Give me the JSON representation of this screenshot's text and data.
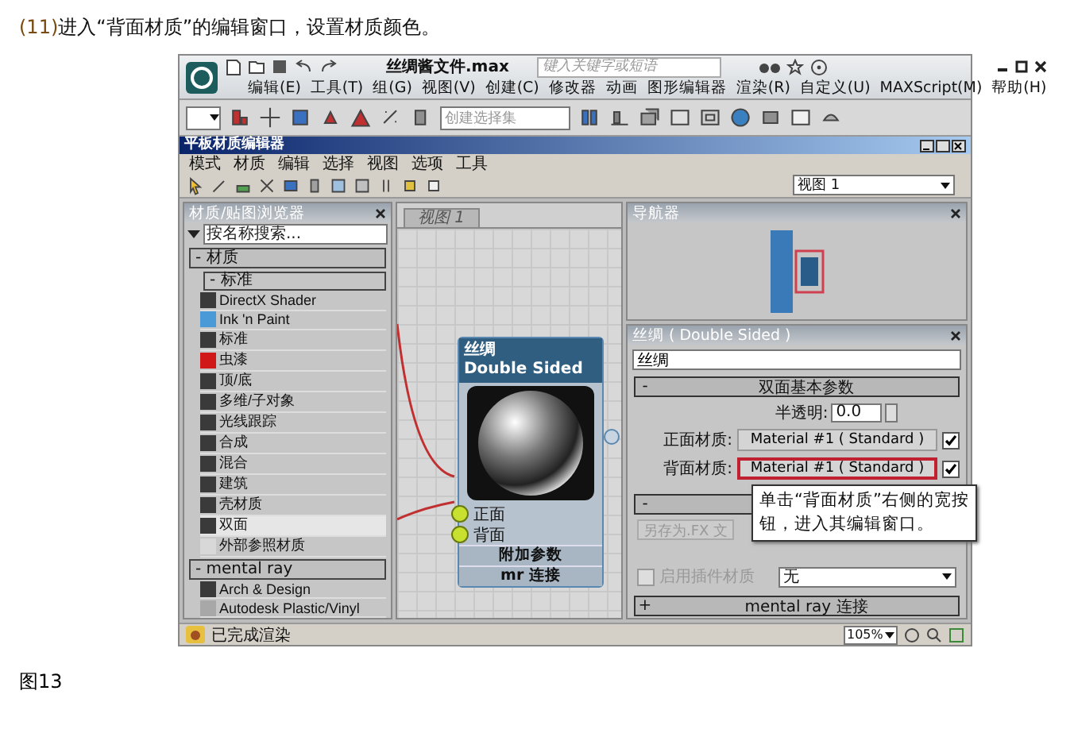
{
  "step_number": "(11)",
  "caption": "进入“背面材质”的编辑窗口，设置材质颜色。",
  "app": {
    "title": "丝绸酱文件.max",
    "search_placeholder": "键入关键字或短语",
    "menu": [
      "编辑(E)",
      "工具(T)",
      "组(G)",
      "视图(V)",
      "创建(C)",
      "修改器",
      "动画",
      "图形编辑器",
      "渲染(R)",
      "自定义(U)",
      "MAXScript(M)",
      "帮助(H)"
    ],
    "selection_set_placeholder": "创建选择集",
    "editor": {
      "title": "平板材质编辑器",
      "menu": [
        "模式",
        "材质",
        "编辑",
        "选择",
        "视图",
        "选项",
        "工具"
      ],
      "view_dropdown": "视图 1",
      "browser": {
        "title": "材质/贴图浏览器",
        "search_placeholder": "按名称搜索...",
        "groups": [
          {
            "label": "- 材质",
            "children": [
              {
                "label": "- 标准",
                "items": [
                  {
                    "label": "DirectX Shader",
                    "color": "#3a3a3a",
                    "selected": false
                  },
                  {
                    "label": "Ink 'n Paint",
                    "color": "#4a9ad8",
                    "selected": false
                  },
                  {
                    "label": "标准",
                    "color": "#3a3a3a",
                    "selected": false
                  },
                  {
                    "label": "虫漆",
                    "color": "#d01818",
                    "selected": false
                  },
                  {
                    "label": "顶/底",
                    "color": "#3a3a3a",
                    "selected": false
                  },
                  {
                    "label": "多维/子对象",
                    "color": "#3a3a3a",
                    "selected": false
                  },
                  {
                    "label": "光线跟踪",
                    "color": "#3a3a3a",
                    "selected": false
                  },
                  {
                    "label": "合成",
                    "color": "#3a3a3a",
                    "selected": false
                  },
                  {
                    "label": "混合",
                    "color": "#3a3a3a",
                    "selected": false
                  },
                  {
                    "label": "建筑",
                    "color": "#3a3a3a",
                    "selected": false
                  },
                  {
                    "label": "壳材质",
                    "color": "#3a3a3a",
                    "selected": false
                  },
                  {
                    "label": "双面",
                    "color": "#3a3a3a",
                    "selected": true
                  },
                  {
                    "label": "外部参照材质",
                    "color": "#d8d8d8",
                    "selected": false
                  }
                ]
              }
            ]
          },
          {
            "label": "- mental ray",
            "children": [
              {
                "items": [
                  {
                    "label": "Arch & Design",
                    "color": "#3a3a3a",
                    "selected": false
                  },
                  {
                    "label": "Autodesk Plastic/Vinyl",
                    "color": "#a8a8a8",
                    "selected": false
                  }
                ]
              }
            ]
          }
        ]
      },
      "view_tab": "视图 1",
      "node": {
        "title": "丝绸",
        "subtitle": "Double Sided",
        "slots": [
          "正面",
          "背面"
        ],
        "rollouts": [
          "附加参数",
          "mr 连接"
        ]
      },
      "navigator": {
        "title": "导航器"
      },
      "params": {
        "title": "丝绸 ( Double Sided )",
        "name": "丝绸",
        "rollout": {
          "sign": "-",
          "label": "双面基本参数"
        },
        "translucency": {
          "label": "半透明:",
          "value": "0.0"
        },
        "materials": [
          {
            "label": "正面材质:",
            "button": "Material #1 ( Standard )",
            "checked": true,
            "highlighted": false
          },
          {
            "label": "背面材质:",
            "button": "Material #1 ( Standard )",
            "checked": true,
            "highlighted": true
          }
        ],
        "rollout2": {
          "sign": "-"
        },
        "fx_button": "另存为.FX 文",
        "plugin": {
          "label": "启用插件材质",
          "checked": false
        },
        "plugin_dropdown": "无",
        "rollout3": {
          "sign": "+",
          "label": "mental ray 连接"
        }
      },
      "callout": "单击“背面材质”右侧的宽按钮，进入其编辑窗口。",
      "status": "已完成渲染",
      "zoom": "105%"
    }
  },
  "figure_label": "图13"
}
